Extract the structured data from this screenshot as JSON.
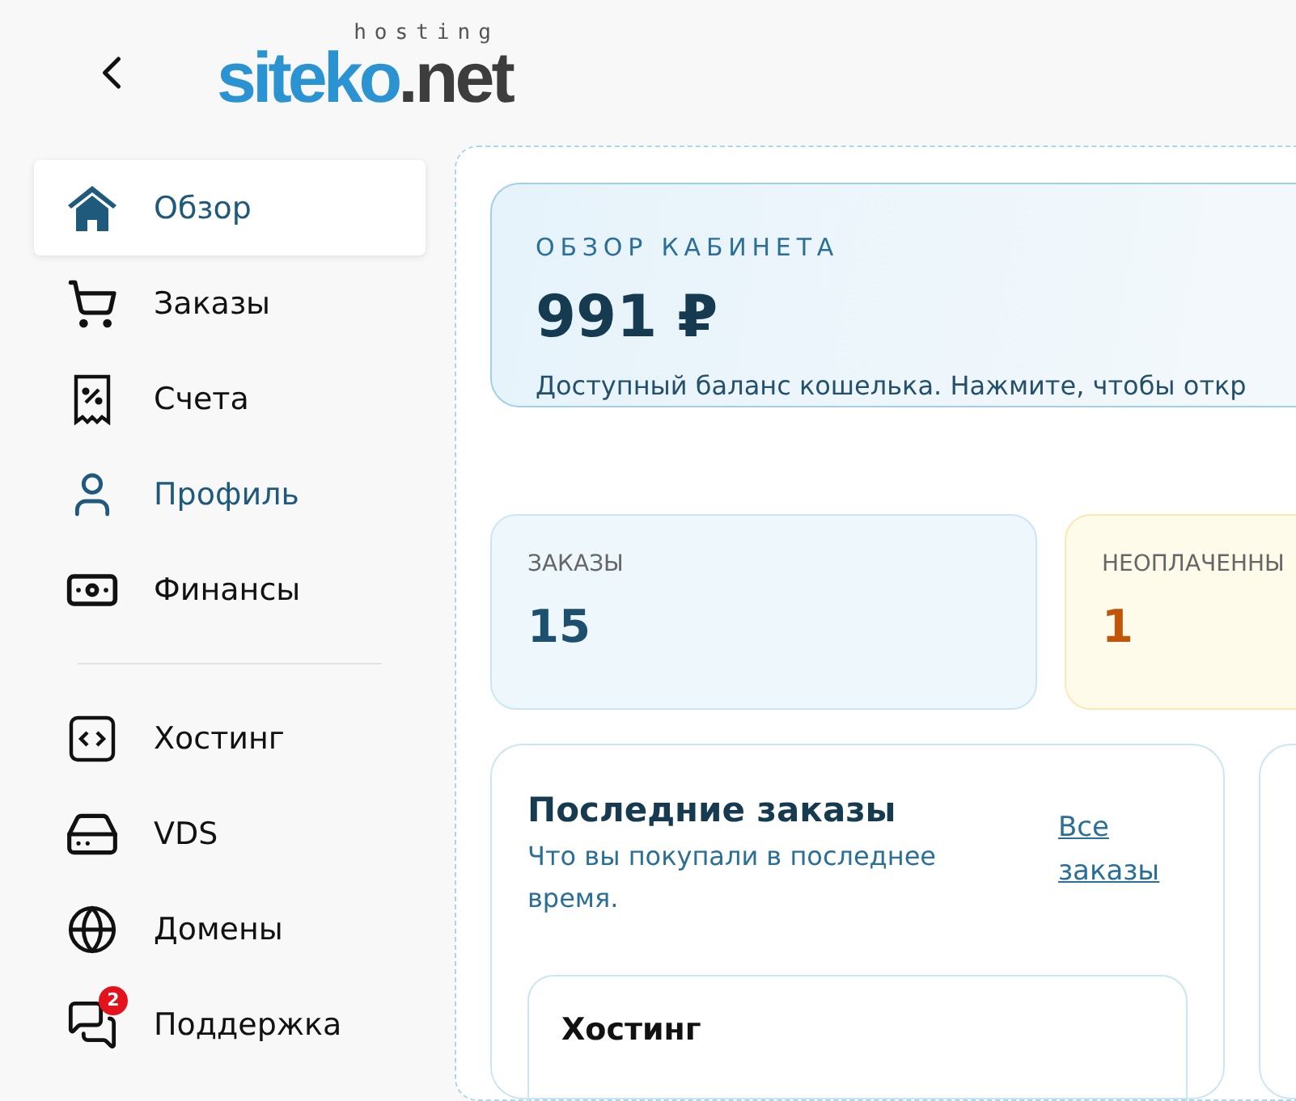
{
  "header": {
    "logo": {
      "brand": "siteko",
      "domain": ".net",
      "tagline": "hosting"
    }
  },
  "sidebar": {
    "groups": [
      {
        "items": [
          {
            "label": "Обзор",
            "selected": true,
            "hovered": false
          },
          {
            "label": "Заказы",
            "selected": false,
            "hovered": false
          },
          {
            "label": "Счета",
            "selected": false,
            "hovered": false
          },
          {
            "label": "Профиль",
            "selected": false,
            "hovered": true
          },
          {
            "label": "Финансы",
            "selected": false,
            "hovered": false
          }
        ]
      },
      {
        "items": [
          {
            "label": "Хостинг",
            "selected": false,
            "hovered": false
          },
          {
            "label": "VDS",
            "selected": false,
            "hovered": false
          },
          {
            "label": "Домены",
            "selected": false,
            "hovered": false
          },
          {
            "label": "Поддержка",
            "selected": false,
            "hovered": false,
            "badge": "2"
          }
        ]
      }
    ]
  },
  "overview": {
    "eyebrow": "ОБЗОР КАБИНЕТА",
    "balance": "991 ₽",
    "description": "Доступный баланс кошелька. Нажмите, чтобы откр"
  },
  "stats": [
    {
      "kind": "info",
      "label": "ЗАКАЗЫ",
      "value": "15"
    },
    {
      "kind": "warning",
      "label": "НЕОПЛАЧЕННЫ",
      "value": "1"
    }
  ],
  "recent_orders": {
    "title": "Последние заказы",
    "subtitle": "Что вы покупали в последнее время.",
    "link": "Все заказы",
    "orders": [
      {
        "name": "Хостинг"
      }
    ]
  }
}
